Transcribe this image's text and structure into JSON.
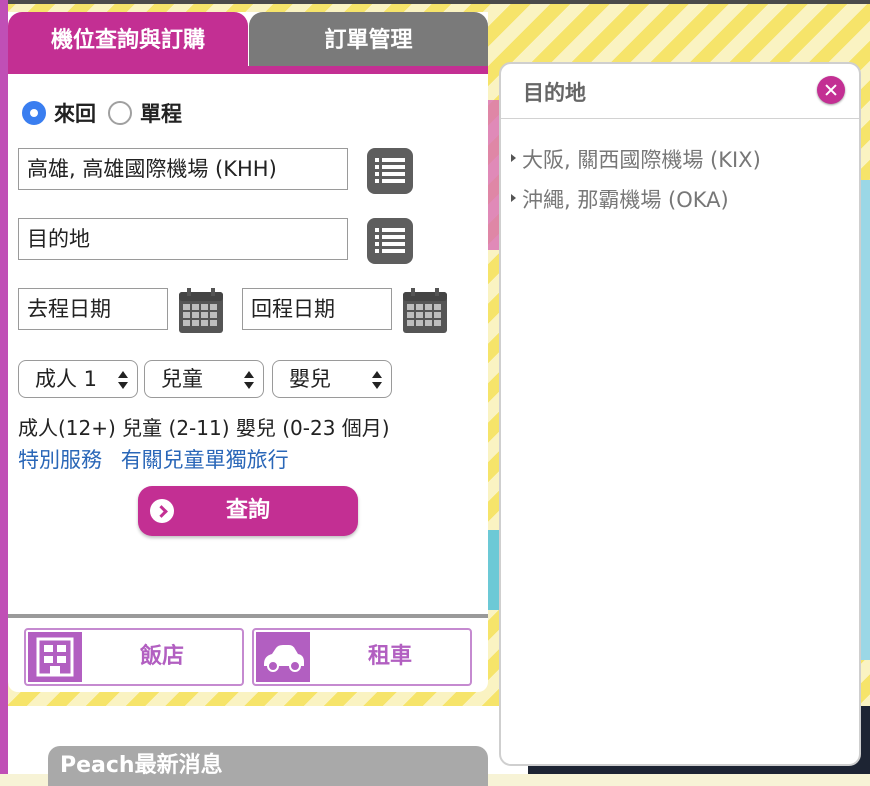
{
  "tabs": {
    "booking": "機位查詢與訂購",
    "manage": "訂單管理"
  },
  "trip_type": {
    "round_trip": "來回",
    "one_way": "單程",
    "selected": "來回"
  },
  "origin": {
    "value": "高雄, 高雄國際機場 (KHH)"
  },
  "destination": {
    "value": "目的地"
  },
  "dates": {
    "depart": "去程日期",
    "return": "回程日期"
  },
  "passengers": {
    "adult": "成人 1",
    "child": "兒童",
    "infant": "嬰兒"
  },
  "age_note": "成人(12+) 兒童 (2-11) 嬰兒 (0-23 個月)",
  "links": {
    "special": "特別服務",
    "unaccompanied": "有關兒童單獨旅行"
  },
  "search_label": "查詢",
  "services": {
    "hotel": "飯店",
    "car": "租車"
  },
  "news_title": "Peach最新消息",
  "popup": {
    "title": "目的地",
    "items": [
      "大阪, 關西國際機場 (KIX)",
      "沖繩, 那霸機場 (OKA)"
    ]
  },
  "colors": {
    "accent": "#c32f93",
    "tab_inactive": "#7a7a7a",
    "link": "#2a67b8",
    "radio_selected": "#3a7ef0"
  }
}
